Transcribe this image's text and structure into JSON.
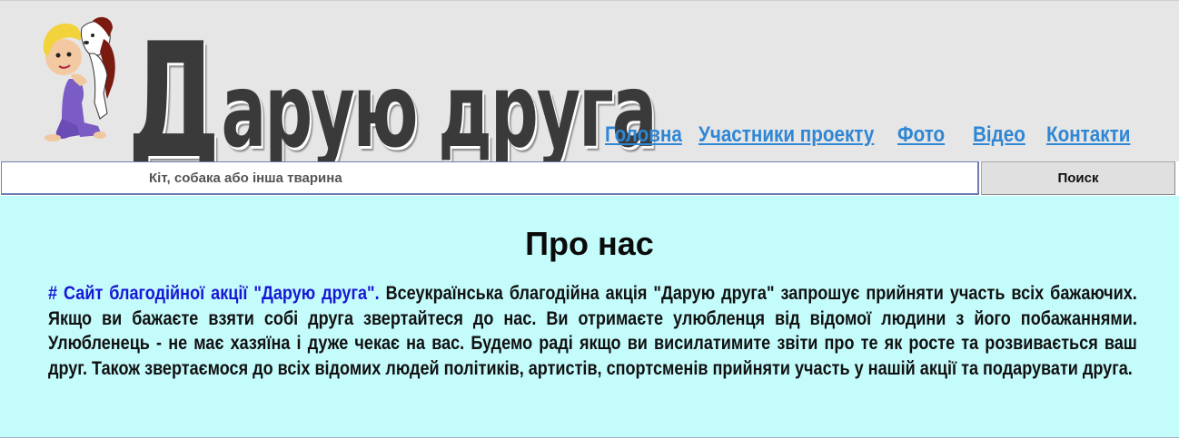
{
  "site": {
    "title_cap": "Д",
    "title_rest": "арую друга"
  },
  "nav": {
    "items": [
      {
        "label": "Головна"
      },
      {
        "label": "Участники проекту"
      },
      {
        "label": "Фото"
      },
      {
        "label": "Відео"
      },
      {
        "label": "Контакти"
      }
    ]
  },
  "search": {
    "placeholder": "Кіт, собака або інша тварина",
    "button_label": "Поиск"
  },
  "main": {
    "heading": "Про нас",
    "link_text": "# Сайт благодійної акції \"Дарую друга\".",
    "body_text": "Всеукраїнська благодійна акція \"Дарую друга\" запрошує прийняти участь всіх бажаючих. Якщо ви бажаєте взяти собі друга звертайтеся до нас. Ви отримаєте улюбленця від відомої людини з його побажаннями. Улюбленець - не має хазяїна і дуже чекає на вас. Будемо раді якщо ви висилатимите звіти про те як росте та розвивається ваш друг. Також звертаємося до всіх відомих людей політиків, артистів, спортсменів прийняти участь у нашій акції та подарувати друга."
  },
  "colors": {
    "header_bg": "#e6e6e6",
    "nav_link": "#2f86d4",
    "content_bg": "#c4fbfb",
    "content_link": "#1717d6"
  }
}
